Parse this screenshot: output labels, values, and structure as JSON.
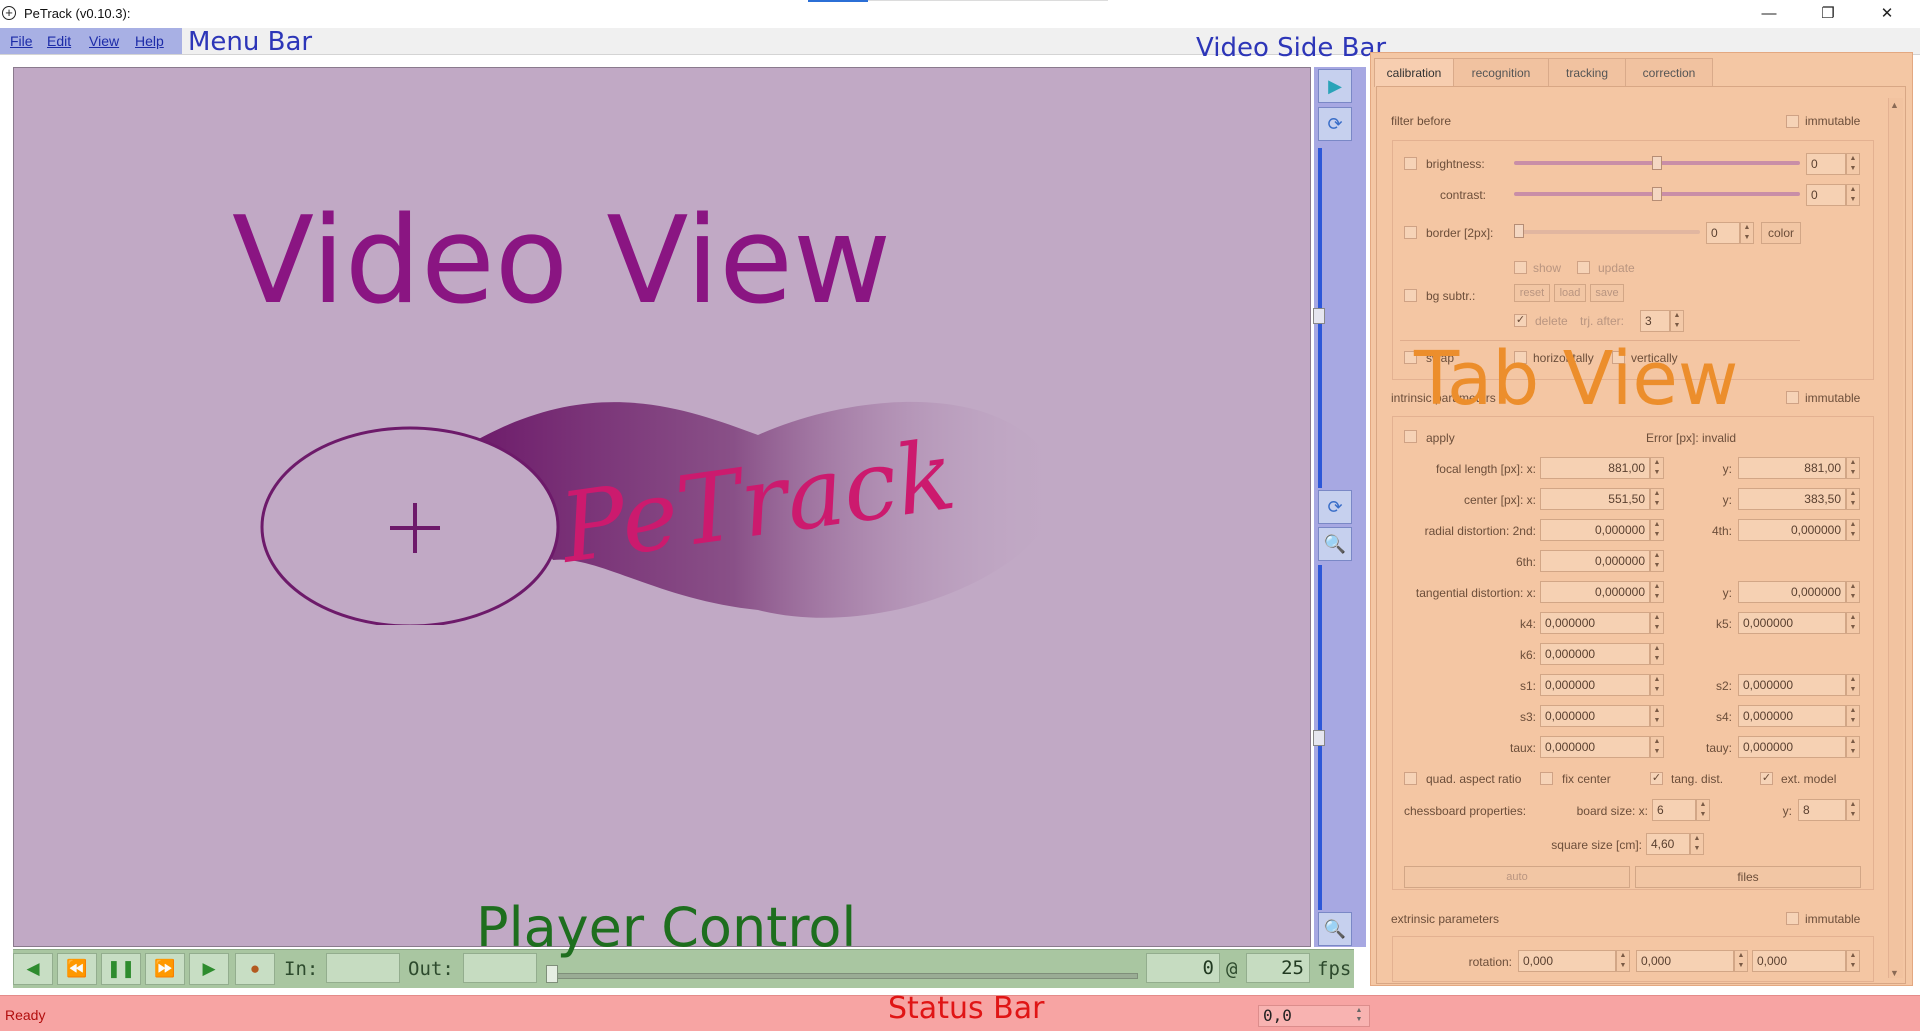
{
  "window": {
    "title": "PeTrack (v0.10.3):",
    "app_icon": "+",
    "minimize_glyph": "—",
    "maximize_glyph": "❐",
    "close_glyph": "✕"
  },
  "menu": {
    "items": [
      "File",
      "Edit",
      "View",
      "Help"
    ]
  },
  "annotations": {
    "menu_bar": "Menu Bar",
    "video_side_bar": "Video Side Bar",
    "video_view": "Video View",
    "tab_view": "Tab View",
    "player_control": "Player Control",
    "status_bar": "Status Bar"
  },
  "logo": {
    "text": "PeTrack",
    "crosshair": "+"
  },
  "side_bar": {
    "icons": [
      "play-arrow-icon",
      "rotate-icon",
      "rotate-icon",
      "zoom-icon",
      "zoom-icon"
    ]
  },
  "tabs": [
    "calibration",
    "recognition",
    "tracking",
    "correction"
  ],
  "active_tab": "calibration",
  "filter_before": {
    "title": "filter before",
    "immutable": "immutable",
    "brightness": {
      "label": "brightness:",
      "value": "0",
      "level": 0.5
    },
    "contrast": {
      "label": "contrast:",
      "value": "0",
      "level": 0.5
    },
    "border": {
      "label": "border [2px]:",
      "value": "0",
      "color_button": "color"
    },
    "show": "show",
    "update": "update",
    "bg_subtr": "bg subtr.:",
    "reset": "reset",
    "load": "load",
    "save": "save",
    "delete": "delete",
    "trj_after": "trj. after:",
    "trj_after_value": "3",
    "swap": "swap",
    "horizontally": "horizontally",
    "vertically": "vertically"
  },
  "intrinsic": {
    "title": "intrinsic parameters",
    "immutable": "immutable",
    "apply": "apply",
    "error": "Error [px]: invalid",
    "focal_label": "focal length [px]: x:",
    "focal_x": "881,00",
    "focal_y": "881,00",
    "center_label": "center [px]: x:",
    "center_x": "551,50",
    "center_y": "383,50",
    "radial_label": "radial distortion: 2nd:",
    "radial_2nd": "0,000000",
    "fourth_label": "4th:",
    "radial_4th": "0,000000",
    "sixth_label": "6th:",
    "radial_6th": "0,000000",
    "tangential_label": "tangential distortion: x:",
    "tangential_x": "0,000000",
    "tangential_y": "0,000000",
    "y_label": "y:",
    "k4_label": "k4:",
    "k4": "0,000000",
    "k5_label": "k5:",
    "k5": "0,000000",
    "k6_label": "k6:",
    "k6": "0,000000",
    "s1_label": "s1:",
    "s1": "0,000000",
    "s2_label": "s2:",
    "s2": "0,000000",
    "s3_label": "s3:",
    "s3": "0,000000",
    "s4_label": "s4:",
    "s4": "0,000000",
    "taux_label": "taux:",
    "taux": "0,000000",
    "tauy_label": "tauy:",
    "tauy": "0,000000",
    "quad_aspect": "quad. aspect ratio",
    "fix_center": "fix center",
    "tang_dist": "tang. dist.",
    "ext_model": "ext. model",
    "chessboard_label": "chessboard properties:",
    "board_size_label": "board size: x:",
    "board_x": "6",
    "board_y": "8",
    "square_label": "square size [cm]:",
    "square_size": "4,60",
    "auto": "auto",
    "files": "files"
  },
  "extrinsic": {
    "title": "extrinsic parameters",
    "immutable": "immutable",
    "rotation_label": "rotation:",
    "rotation": [
      "0,000",
      "0,000",
      "0,000"
    ]
  },
  "player": {
    "in_label": "In:",
    "out_label": "Out:",
    "in_value": "",
    "out_value": "",
    "frame": "0",
    "at": "@",
    "fps_value": "25",
    "fps_label": "fps",
    "position": 0.0
  },
  "status": {
    "text": "Ready",
    "coords": "0,0"
  },
  "colors": {
    "video_bg": "#c1a9c5",
    "logo_purple": "#6d1a6a",
    "logo_pink": "#cc1a6e"
  }
}
